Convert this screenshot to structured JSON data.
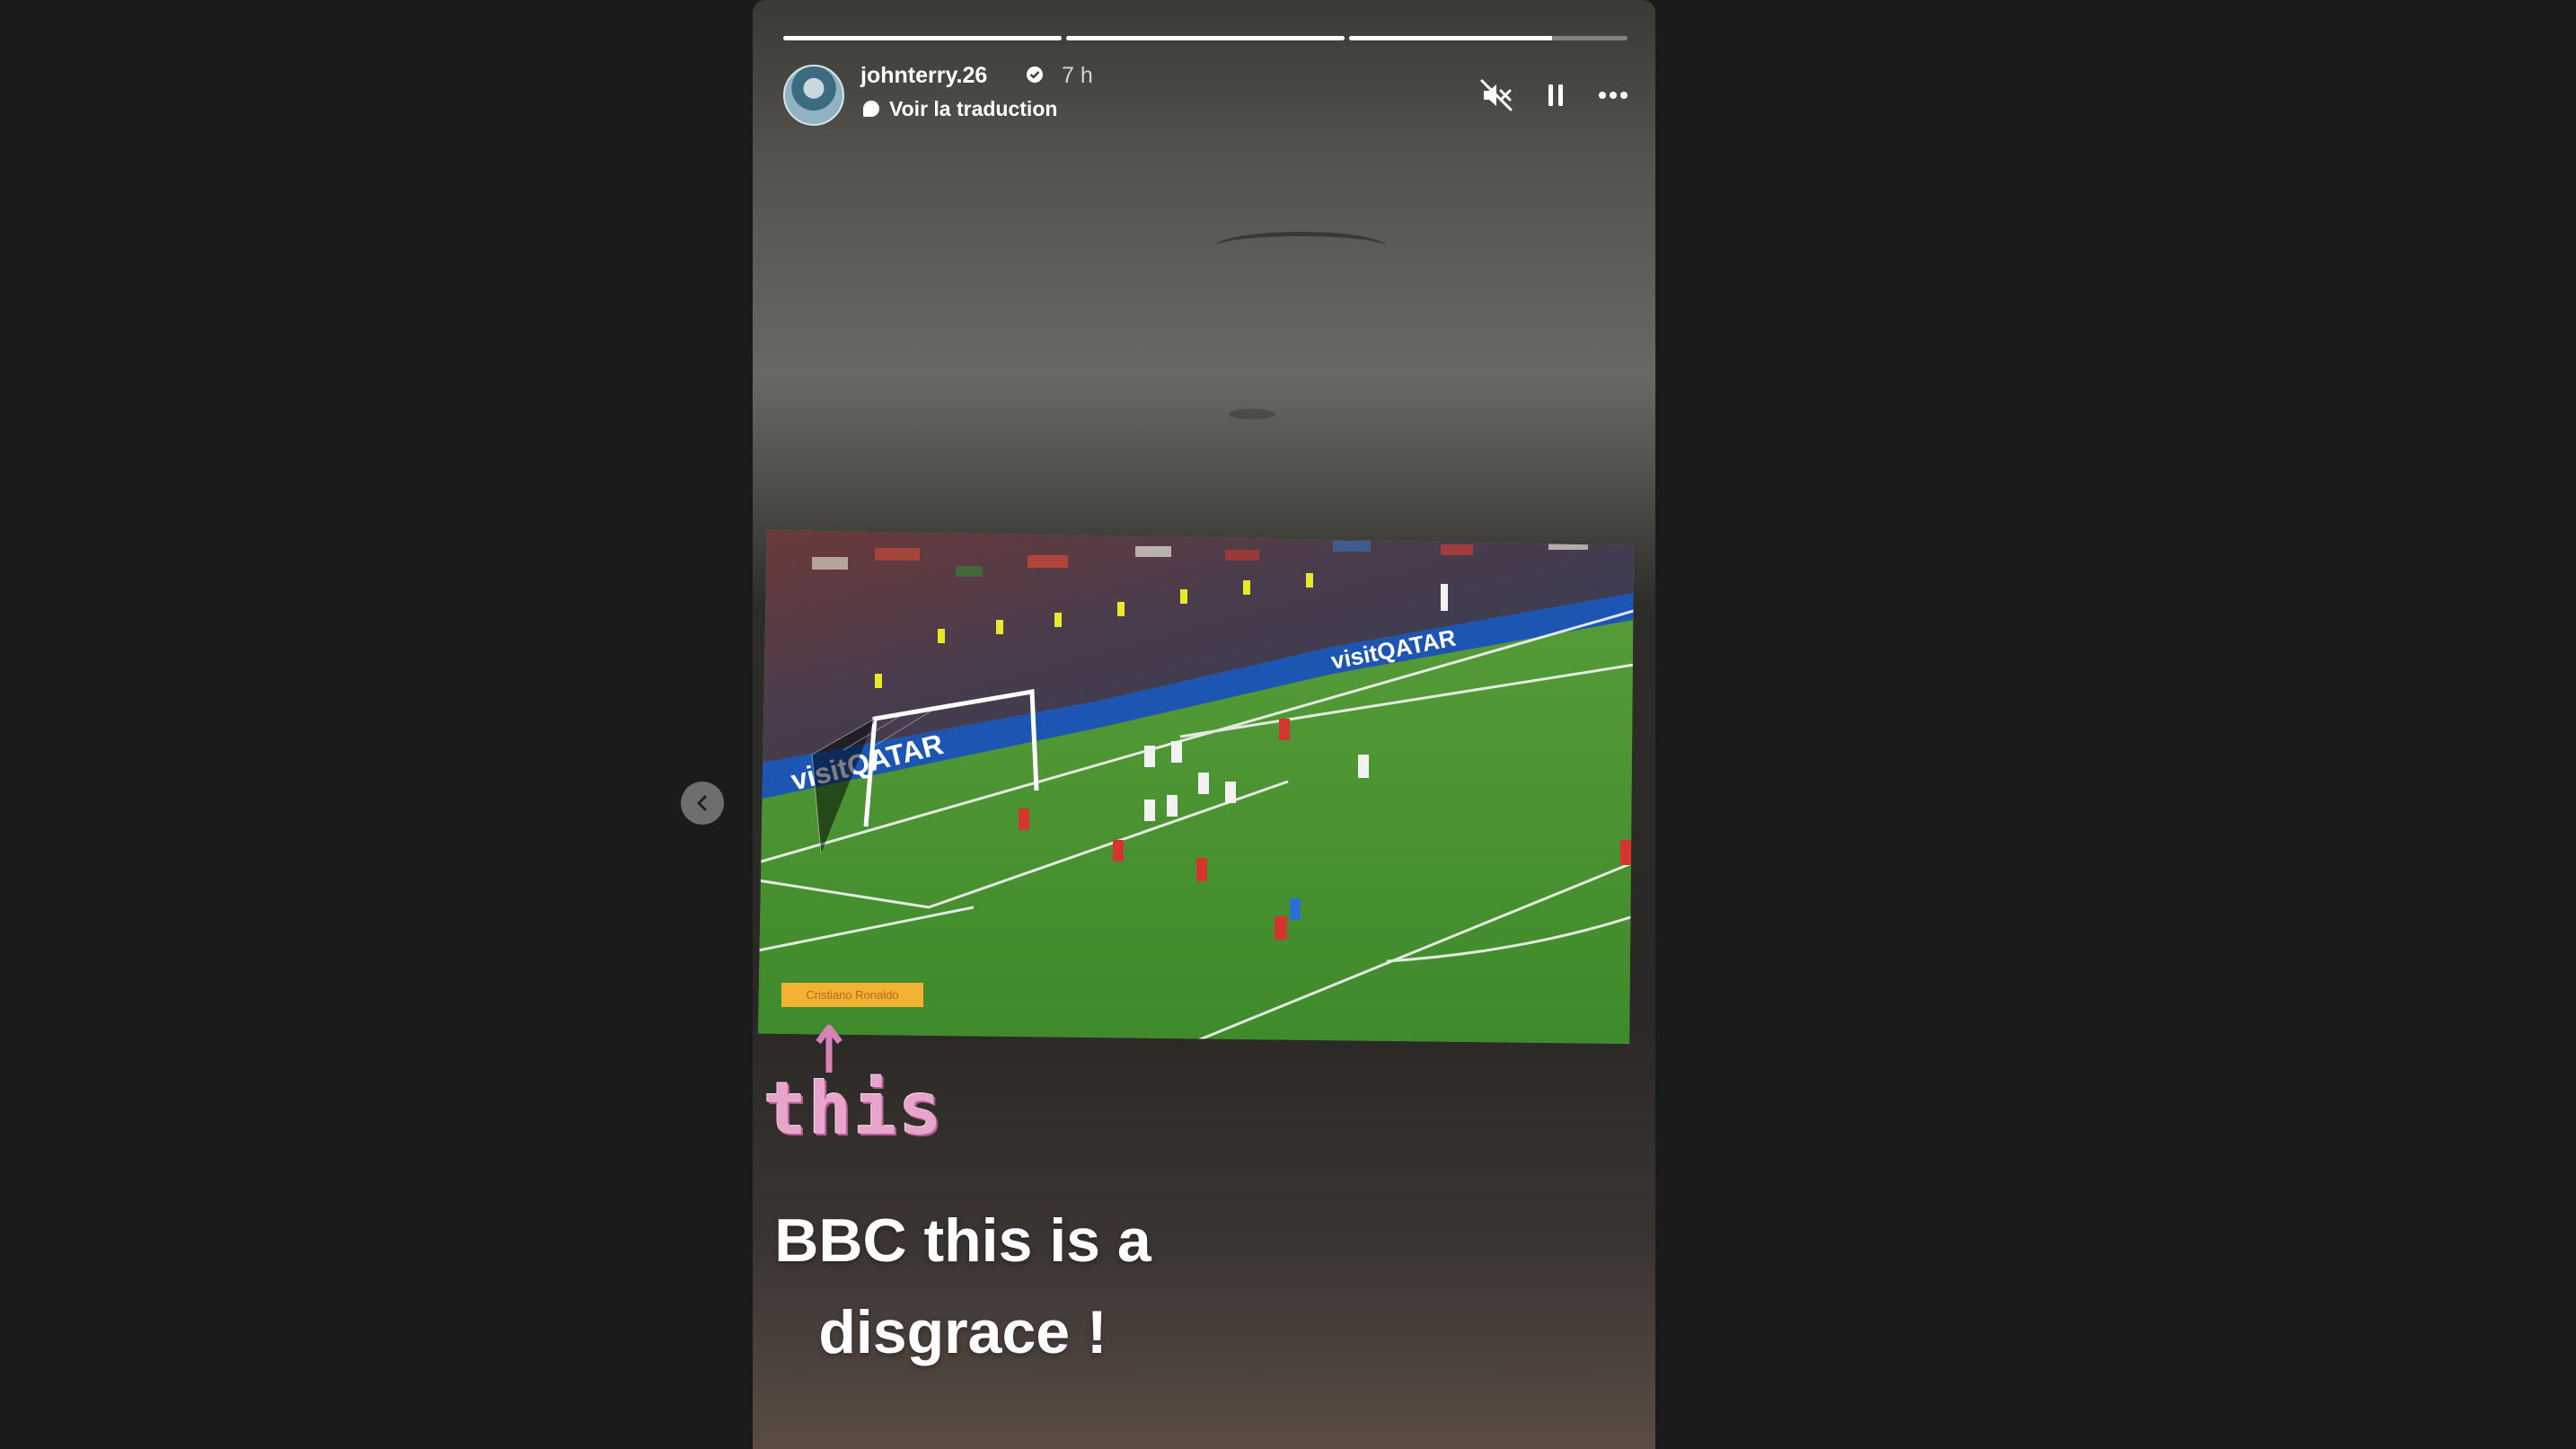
{
  "story": {
    "username": "johnterry.26",
    "time_ago": "7 h",
    "translate_label": "Voir la traduction",
    "progress": [
      1,
      1,
      0.73
    ],
    "tv_caption": "Cristiano Ronaldo",
    "sticker_text": "this",
    "caption_line1": "BBC this is a",
    "caption_line2": "disgrace !",
    "broadcast_board_text": "visitQATAR"
  },
  "controls": {
    "mute_icon": "speaker-muted-icon",
    "pause_icon": "pause-icon",
    "more_icon": "more-horizontal-icon",
    "prev_icon": "chevron-left-icon"
  },
  "colors": {
    "page_background": "#1b1b1b",
    "pitch": "#4a8a32",
    "sticker_pink": "#e8a5cc",
    "caption_label_bg": "#f2b333"
  }
}
